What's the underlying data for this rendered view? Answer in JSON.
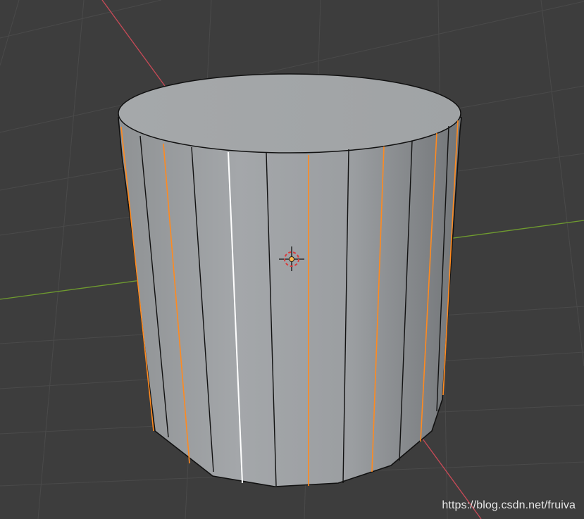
{
  "viewport": {
    "background_color": "#3d3d3d",
    "grid_color": "#4a4a4a",
    "axis_x_color": "#c84a57",
    "axis_y_color": "#6f9b2f"
  },
  "object": {
    "shape": "cylinder",
    "body_color": "#9da0a3",
    "top_color": "#a8abad",
    "edge_color": "#111111",
    "selected_edge_color": "#ff8a1f",
    "active_edge_color": "#ffffff"
  },
  "cursor": {
    "icon": "3d-cursor-icon",
    "color": "#d83b3b",
    "center_color": "#ffb84d"
  },
  "watermark": {
    "text": "https://blog.csdn.net/fruiva"
  }
}
